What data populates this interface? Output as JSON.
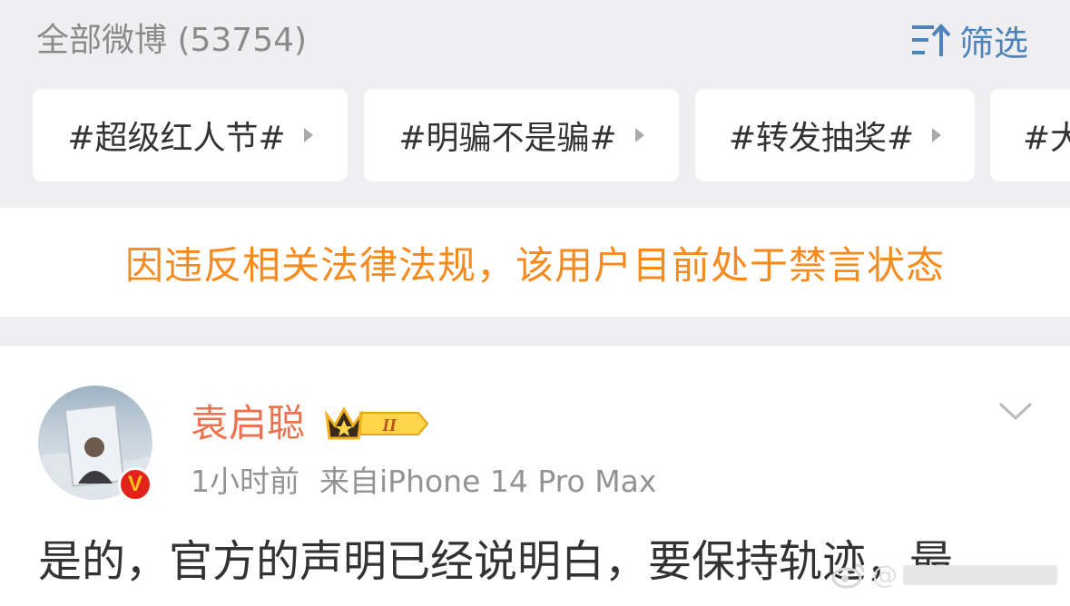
{
  "header": {
    "weibo_count_label": "全部微博 (53754)",
    "filter_label": "筛选",
    "filter_icon": "sort-filter-icon"
  },
  "tags": [
    {
      "label": "#超级红人节#"
    },
    {
      "label": "#明骗不是骗#"
    },
    {
      "label": "#转发抽奖#"
    },
    {
      "label": "#大"
    }
  ],
  "notice": {
    "text": "因违反相关法律法规，该用户目前处于禁言状态"
  },
  "post": {
    "username": "袁启聪",
    "member_level": "II",
    "verified_badge": "V",
    "time": "1小时前",
    "source": "来自iPhone 14 Pro Max",
    "content": "是的，官方的声明已经说明白，要保持轨迹，最",
    "watermark": "@"
  },
  "colors": {
    "accent_blue": "#4f84ba",
    "notice_orange": "#f58b1e",
    "username_orange": "#eb7350",
    "badge_red": "#e2231a",
    "background": "#efeff1"
  }
}
